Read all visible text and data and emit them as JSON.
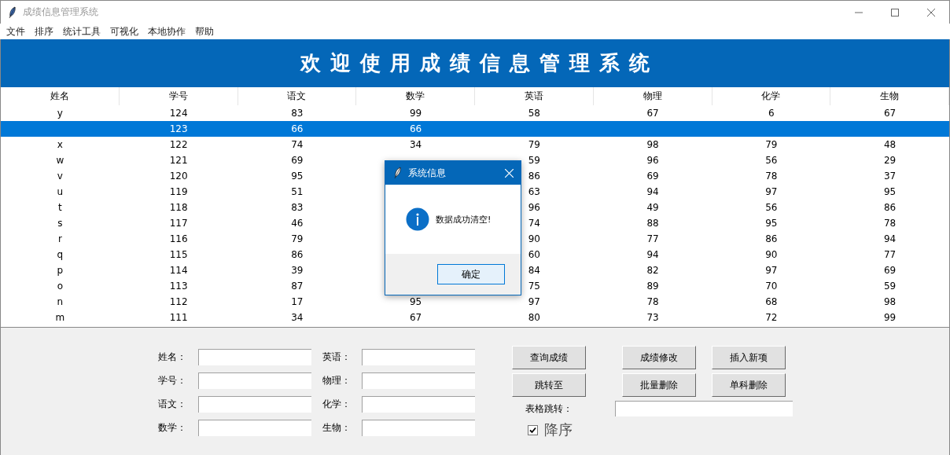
{
  "window": {
    "title": "成绩信息管理系统"
  },
  "menu": [
    "文件",
    "排序",
    "统计工具",
    "可视化",
    "本地协作",
    "帮助"
  ],
  "banner": {
    "title": "欢迎使用成绩信息管理系统"
  },
  "table": {
    "columns": [
      "姓名",
      "学号",
      "语文",
      "数学",
      "英语",
      "物理",
      "化学",
      "生物"
    ],
    "rows": [
      {
        "cells": [
          "y",
          "124",
          "83",
          "99",
          "58",
          "67",
          "6",
          "67"
        ],
        "selected": false
      },
      {
        "cells": [
          "",
          "123",
          "66",
          "66",
          "",
          "",
          "",
          ""
        ],
        "selected": true
      },
      {
        "cells": [
          "x",
          "122",
          "74",
          "34",
          "79",
          "98",
          "79",
          "48"
        ],
        "selected": false
      },
      {
        "cells": [
          "w",
          "121",
          "69",
          null,
          "59",
          "96",
          "56",
          "29"
        ],
        "selected": false
      },
      {
        "cells": [
          "v",
          "120",
          "95",
          null,
          "86",
          "69",
          "78",
          "37"
        ],
        "selected": false
      },
      {
        "cells": [
          "u",
          "119",
          "51",
          null,
          "63",
          "94",
          "97",
          "95"
        ],
        "selected": false
      },
      {
        "cells": [
          "t",
          "118",
          "83",
          null,
          "96",
          "49",
          "56",
          "86"
        ],
        "selected": false
      },
      {
        "cells": [
          "s",
          "117",
          "46",
          null,
          "74",
          "88",
          "95",
          "78"
        ],
        "selected": false
      },
      {
        "cells": [
          "r",
          "116",
          "79",
          null,
          "90",
          "77",
          "86",
          "94"
        ],
        "selected": false
      },
      {
        "cells": [
          "q",
          "115",
          "86",
          null,
          "60",
          "94",
          "90",
          "77"
        ],
        "selected": false
      },
      {
        "cells": [
          "p",
          "114",
          "39",
          null,
          "84",
          "82",
          "97",
          "69"
        ],
        "selected": false
      },
      {
        "cells": [
          "o",
          "113",
          "87",
          null,
          "75",
          "89",
          "70",
          "59"
        ],
        "selected": false
      },
      {
        "cells": [
          "n",
          "112",
          "17",
          "95",
          "97",
          "78",
          "68",
          "98"
        ],
        "selected": false
      },
      {
        "cells": [
          "m",
          "111",
          "34",
          "67",
          "80",
          "73",
          "72",
          "99"
        ],
        "selected": false
      }
    ]
  },
  "form": {
    "fields": [
      {
        "label": "姓名："
      },
      {
        "label": "英语："
      },
      {
        "label": "学号："
      },
      {
        "label": "物理："
      },
      {
        "label": "语文："
      },
      {
        "label": "化学："
      },
      {
        "label": "数学："
      },
      {
        "label": "生物："
      }
    ],
    "buttons": [
      [
        "查询成绩",
        "成绩修改",
        "插入新项"
      ],
      [
        "跳转至",
        "批量删除",
        "单科删除"
      ]
    ],
    "jump": {
      "label": "表格跳转："
    },
    "descending": {
      "label": "降序",
      "checked": true
    }
  },
  "dialog": {
    "title": "系统信息",
    "message": "数据成功清空!",
    "button": "确定"
  }
}
